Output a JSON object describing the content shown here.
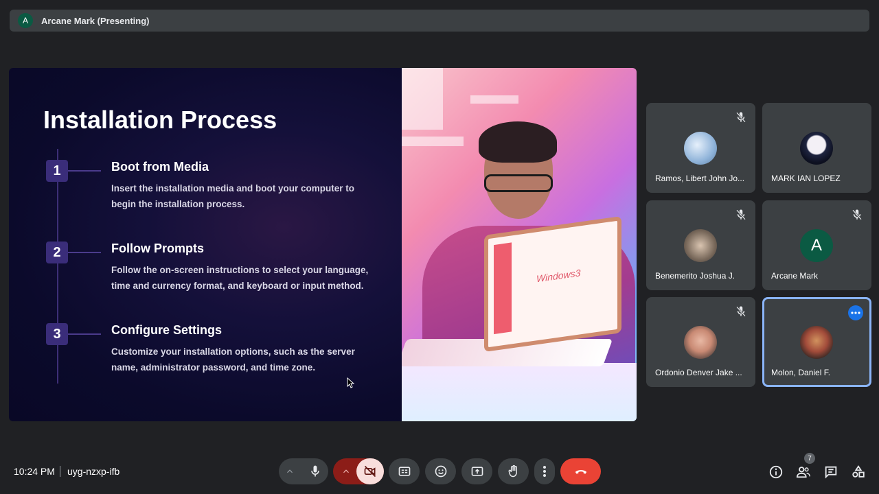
{
  "presenter": {
    "avatar_letter": "A",
    "label": "Arcane Mark (Presenting)"
  },
  "slide": {
    "title": "Installation Process",
    "steps": [
      {
        "number": "1",
        "title": "Boot from Media",
        "description": "Insert the installation media and boot your computer to begin the installation process."
      },
      {
        "number": "2",
        "title": "Follow Prompts",
        "description": "Follow the on-screen instructions to select your language, time and currency format, and keyboard or input method."
      },
      {
        "number": "3",
        "title": "Configure Settings",
        "description": "Customize your installation options, such as the server name, administrator password, and time zone."
      }
    ],
    "illustration_text": "Windows3"
  },
  "participants": [
    {
      "name": "Ramos, Libert John Jo...",
      "muted": true,
      "avatar": "globe-photo"
    },
    {
      "name": "MARK IAN LOPEZ",
      "muted": false,
      "avatar": "anime-photo"
    },
    {
      "name": "Benemerito Joshua J.",
      "muted": true,
      "avatar": "bike-photo"
    },
    {
      "name": "Arcane Mark",
      "muted": true,
      "avatar_letter": "A"
    },
    {
      "name": "Ordonio Denver Jake ...",
      "muted": true,
      "avatar": "person-photo"
    },
    {
      "name": "Molon, Daniel F.",
      "muted": false,
      "active": true,
      "avatar": "person-photo"
    }
  ],
  "footer": {
    "time": "10:24 PM",
    "meeting_code": "uyg-nzxp-ifb",
    "participant_count": "7"
  },
  "colors": {
    "end_call": "#ea4335",
    "camera_off_bg": "#f9dedc",
    "camera_off_chevron_bg": "#8c1d18",
    "active_border": "#8ab4f8"
  }
}
